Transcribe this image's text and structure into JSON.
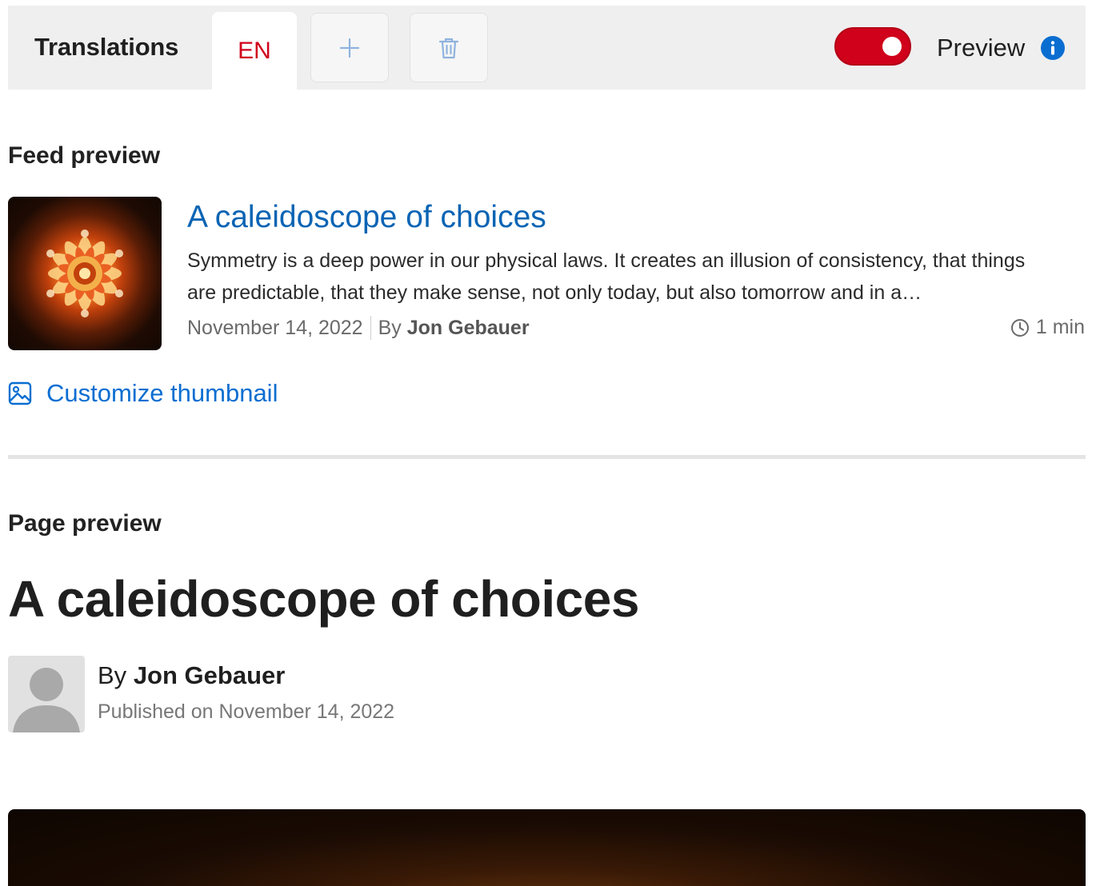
{
  "topbar": {
    "title": "Translations",
    "active_language": "EN",
    "add_label": "+",
    "preview_label": "Preview",
    "preview_enabled": true,
    "accent_color": "#d0021b"
  },
  "feed_preview": {
    "section_title": "Feed preview",
    "title": "A caleidoscope of choices",
    "excerpt": "Symmetry is a deep power in our physical laws. It creates an illusion of consistency, that things are predictable, that they make sense, not only today, but also tomorrow and in a…",
    "date": "November 14, 2022",
    "by_prefix": "By",
    "author": "Jon Gebauer",
    "read_time": "1 min",
    "customize_label": "Customize thumbnail",
    "link_color": "#0a64b4"
  },
  "page_preview": {
    "section_title": "Page preview",
    "title": "A caleidoscope of choices",
    "by_prefix": "By",
    "author": "Jon Gebauer",
    "published": "Published on November 14, 2022"
  }
}
